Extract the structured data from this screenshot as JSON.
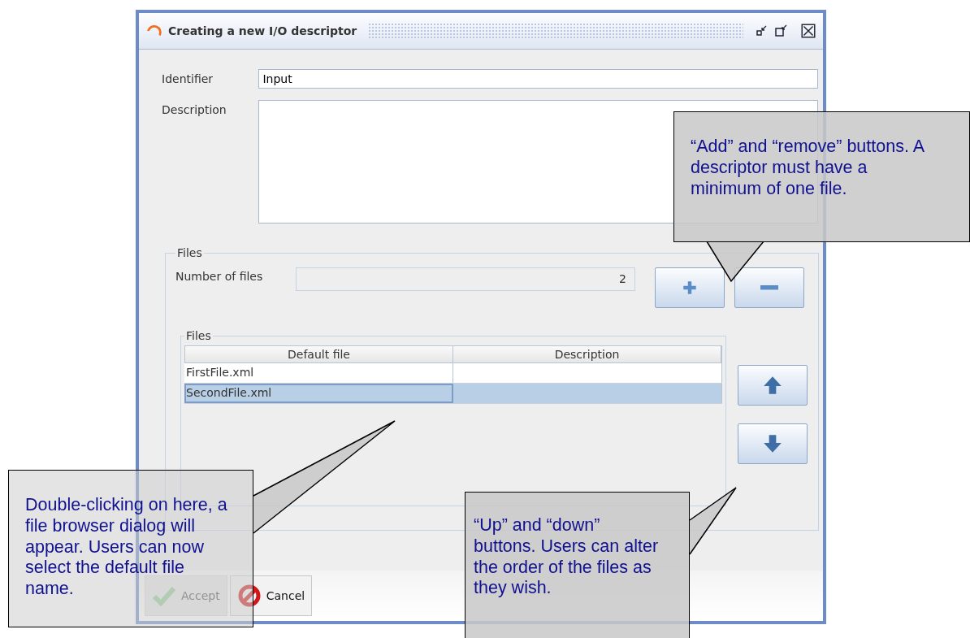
{
  "window": {
    "title": "Creating a new I/O descriptor"
  },
  "identifier": {
    "label": "Identifier",
    "value": "Input"
  },
  "description": {
    "label": "Description"
  },
  "files_group": {
    "title": "Files",
    "number_of_files": {
      "label": "Number of files",
      "value": "2"
    },
    "files_table": {
      "title": "Files",
      "columns": [
        "Default file",
        "Description"
      ],
      "rows": [
        {
          "default_file": "FirstFile.xml",
          "selected": false
        },
        {
          "default_file": "SecondFile.xml",
          "selected": true
        }
      ]
    }
  },
  "buttons": [
    {
      "label": "Accept",
      "kind": "accept",
      "disabled": true
    },
    {
      "label": "Cancel",
      "kind": "cancel",
      "disabled": false
    }
  ],
  "callouts": [
    {
      "text": "“Add” and “remove” buttons. A descriptor must have a minimum of one file."
    },
    {
      "text": "Double-clicking on here, a file browser dialog will appear. Users can now select the default file name."
    },
    {
      "text": "“Up” and “down” buttons. Users can alter the order of the files as they wish."
    }
  ]
}
